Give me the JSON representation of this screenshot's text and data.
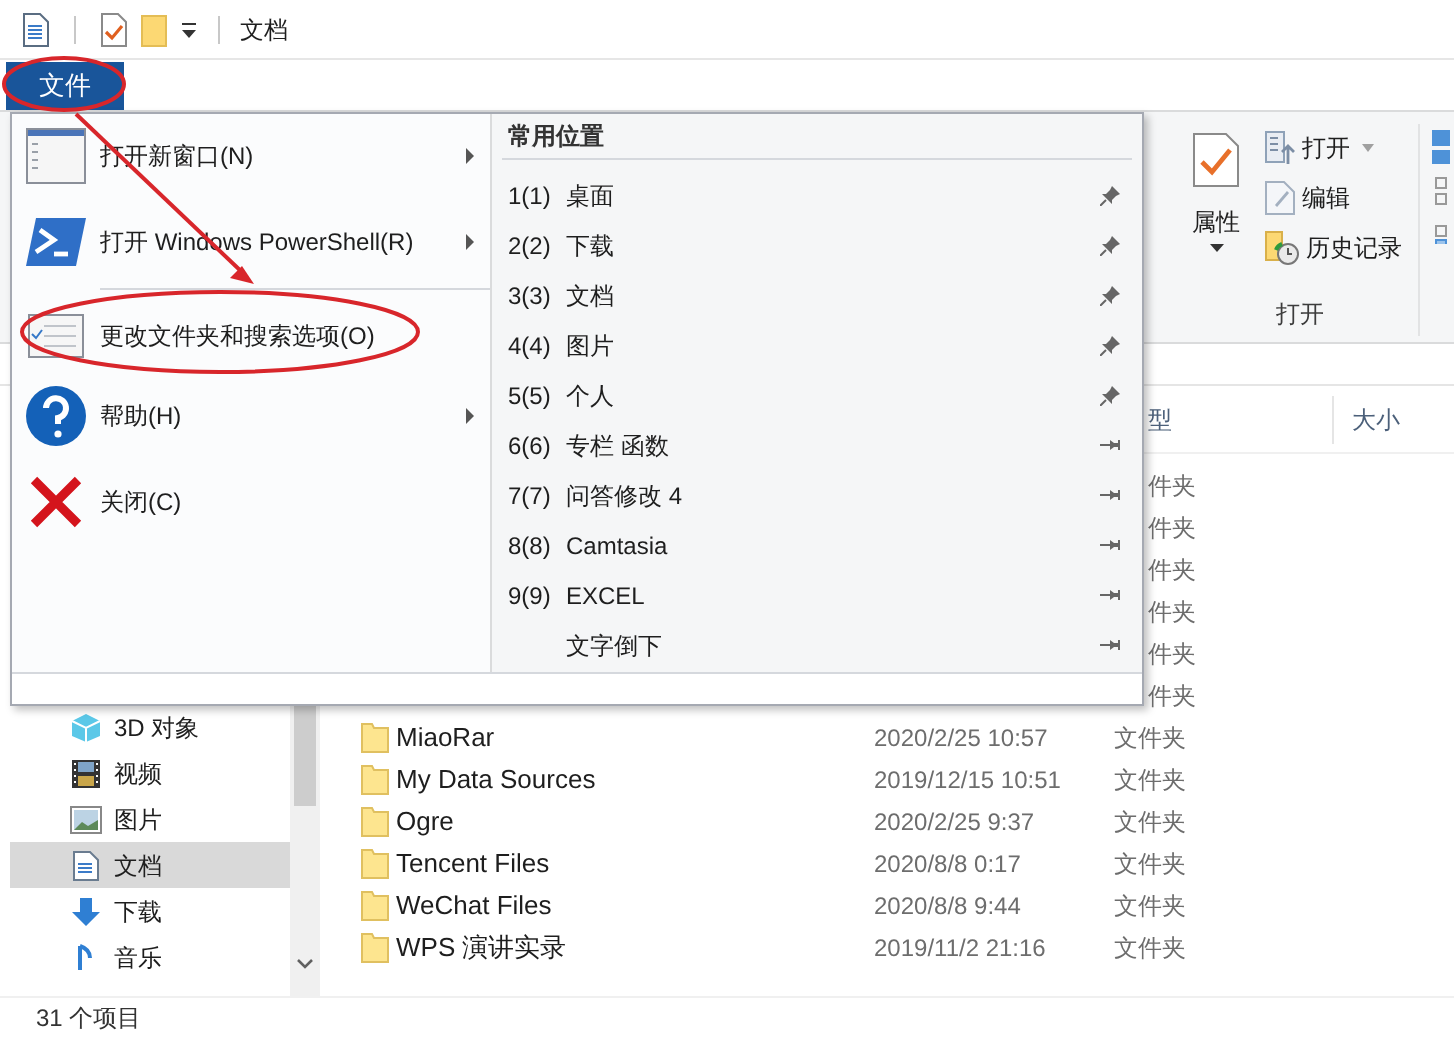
{
  "title_bar": {
    "title": "文档"
  },
  "file_tab": {
    "label": "文件",
    "selected": true
  },
  "ribbon": {
    "properties": {
      "label": "属性"
    },
    "small_buttons": [
      {
        "label": "打开",
        "dropdown": true
      },
      {
        "label": "编辑",
        "dropdown": false
      },
      {
        "label": "历史记录",
        "dropdown": false
      }
    ],
    "group_label": "打开"
  },
  "nav_pane": {
    "items": [
      {
        "label": "3D 对象",
        "selected": false
      },
      {
        "label": "视频",
        "selected": false
      },
      {
        "label": "图片",
        "selected": false
      },
      {
        "label": "文档",
        "selected": true
      },
      {
        "label": "下载",
        "selected": false
      },
      {
        "label": "音乐",
        "selected": false
      }
    ]
  },
  "file_list": {
    "columns": [
      "型",
      "大小"
    ],
    "rows": [
      {
        "type": "件夹"
      },
      {
        "type": "件夹"
      },
      {
        "type": "件夹"
      },
      {
        "type": "件夹"
      },
      {
        "type": "件夹"
      },
      {
        "type": "件夹"
      },
      {
        "name": "MiaoRar",
        "date": "2020/2/25 10:57",
        "type": "文件夹"
      },
      {
        "name": "My Data Sources",
        "date": "2019/12/15 10:51",
        "type": "文件夹"
      },
      {
        "name": "Ogre",
        "date": "2020/2/25 9:37",
        "type": "文件夹"
      },
      {
        "name": "Tencent Files",
        "date": "2020/8/8 0:17",
        "type": "文件夹"
      },
      {
        "name": "WeChat Files",
        "date": "2020/8/8 9:44",
        "type": "文件夹"
      },
      {
        "name": "WPS 演讲实录",
        "date": "2019/11/2 21:16",
        "type": "文件夹"
      }
    ]
  },
  "status_bar": {
    "text": "31 个项目"
  },
  "file_menu": {
    "commands": [
      {
        "label": "打开新窗口(N)",
        "submenu": true,
        "separator_before": false
      },
      {
        "label": "打开 Windows PowerShell(R)",
        "submenu": true,
        "separator_before": false
      },
      {
        "label": "更改文件夹和搜索选项(O)",
        "submenu": false,
        "separator_before": true
      },
      {
        "label": "帮助(H)",
        "submenu": true,
        "separator_before": false
      },
      {
        "label": "关闭(C)",
        "submenu": false,
        "separator_before": false
      }
    ],
    "places_title": "常用位置",
    "places": [
      {
        "key": "1(1)",
        "label": "桌面",
        "pinned": true
      },
      {
        "key": "2(2)",
        "label": "下载",
        "pinned": true
      },
      {
        "key": "3(3)",
        "label": "文档",
        "pinned": true
      },
      {
        "key": "4(4)",
        "label": "图片",
        "pinned": true
      },
      {
        "key": "5(5)",
        "label": "个人",
        "pinned": true
      },
      {
        "key": "6(6)",
        "label": "专栏 函数",
        "pinned": false
      },
      {
        "key": "7(7)",
        "label": "问答修改 4",
        "pinned": false
      },
      {
        "key": "8(8)",
        "label": "Camtasia",
        "pinned": false
      },
      {
        "key": "9(9)",
        "label": "EXCEL",
        "pinned": false
      },
      {
        "label": "文字倒下",
        "pinned": false
      }
    ]
  }
}
